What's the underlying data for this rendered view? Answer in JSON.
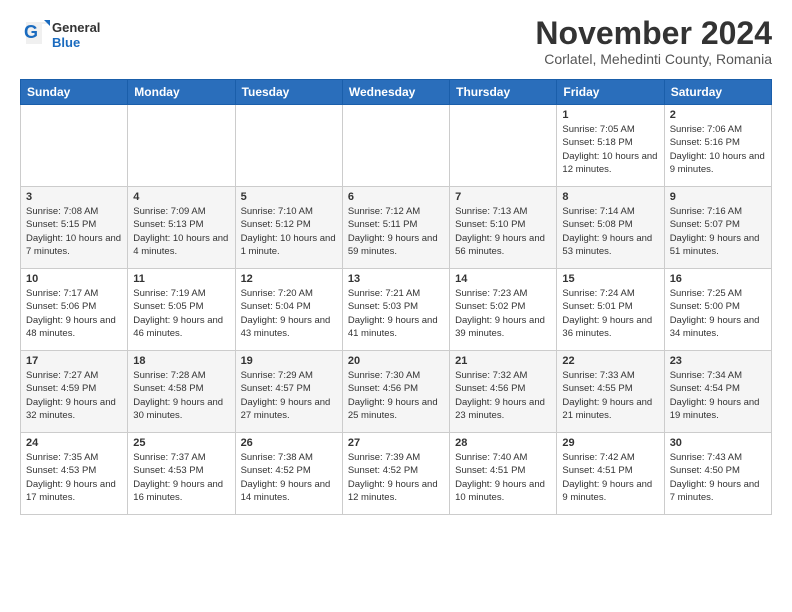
{
  "logo": {
    "general": "General",
    "blue": "Blue"
  },
  "title": "November 2024",
  "subtitle": "Corlatel, Mehedinti County, Romania",
  "headers": [
    "Sunday",
    "Monday",
    "Tuesday",
    "Wednesday",
    "Thursday",
    "Friday",
    "Saturday"
  ],
  "weeks": [
    [
      {
        "day": "",
        "info": ""
      },
      {
        "day": "",
        "info": ""
      },
      {
        "day": "",
        "info": ""
      },
      {
        "day": "",
        "info": ""
      },
      {
        "day": "",
        "info": ""
      },
      {
        "day": "1",
        "info": "Sunrise: 7:05 AM\nSunset: 5:18 PM\nDaylight: 10 hours and 12 minutes."
      },
      {
        "day": "2",
        "info": "Sunrise: 7:06 AM\nSunset: 5:16 PM\nDaylight: 10 hours and 9 minutes."
      }
    ],
    [
      {
        "day": "3",
        "info": "Sunrise: 7:08 AM\nSunset: 5:15 PM\nDaylight: 10 hours and 7 minutes."
      },
      {
        "day": "4",
        "info": "Sunrise: 7:09 AM\nSunset: 5:13 PM\nDaylight: 10 hours and 4 minutes."
      },
      {
        "day": "5",
        "info": "Sunrise: 7:10 AM\nSunset: 5:12 PM\nDaylight: 10 hours and 1 minute."
      },
      {
        "day": "6",
        "info": "Sunrise: 7:12 AM\nSunset: 5:11 PM\nDaylight: 9 hours and 59 minutes."
      },
      {
        "day": "7",
        "info": "Sunrise: 7:13 AM\nSunset: 5:10 PM\nDaylight: 9 hours and 56 minutes."
      },
      {
        "day": "8",
        "info": "Sunrise: 7:14 AM\nSunset: 5:08 PM\nDaylight: 9 hours and 53 minutes."
      },
      {
        "day": "9",
        "info": "Sunrise: 7:16 AM\nSunset: 5:07 PM\nDaylight: 9 hours and 51 minutes."
      }
    ],
    [
      {
        "day": "10",
        "info": "Sunrise: 7:17 AM\nSunset: 5:06 PM\nDaylight: 9 hours and 48 minutes."
      },
      {
        "day": "11",
        "info": "Sunrise: 7:19 AM\nSunset: 5:05 PM\nDaylight: 9 hours and 46 minutes."
      },
      {
        "day": "12",
        "info": "Sunrise: 7:20 AM\nSunset: 5:04 PM\nDaylight: 9 hours and 43 minutes."
      },
      {
        "day": "13",
        "info": "Sunrise: 7:21 AM\nSunset: 5:03 PM\nDaylight: 9 hours and 41 minutes."
      },
      {
        "day": "14",
        "info": "Sunrise: 7:23 AM\nSunset: 5:02 PM\nDaylight: 9 hours and 39 minutes."
      },
      {
        "day": "15",
        "info": "Sunrise: 7:24 AM\nSunset: 5:01 PM\nDaylight: 9 hours and 36 minutes."
      },
      {
        "day": "16",
        "info": "Sunrise: 7:25 AM\nSunset: 5:00 PM\nDaylight: 9 hours and 34 minutes."
      }
    ],
    [
      {
        "day": "17",
        "info": "Sunrise: 7:27 AM\nSunset: 4:59 PM\nDaylight: 9 hours and 32 minutes."
      },
      {
        "day": "18",
        "info": "Sunrise: 7:28 AM\nSunset: 4:58 PM\nDaylight: 9 hours and 30 minutes."
      },
      {
        "day": "19",
        "info": "Sunrise: 7:29 AM\nSunset: 4:57 PM\nDaylight: 9 hours and 27 minutes."
      },
      {
        "day": "20",
        "info": "Sunrise: 7:30 AM\nSunset: 4:56 PM\nDaylight: 9 hours and 25 minutes."
      },
      {
        "day": "21",
        "info": "Sunrise: 7:32 AM\nSunset: 4:56 PM\nDaylight: 9 hours and 23 minutes."
      },
      {
        "day": "22",
        "info": "Sunrise: 7:33 AM\nSunset: 4:55 PM\nDaylight: 9 hours and 21 minutes."
      },
      {
        "day": "23",
        "info": "Sunrise: 7:34 AM\nSunset: 4:54 PM\nDaylight: 9 hours and 19 minutes."
      }
    ],
    [
      {
        "day": "24",
        "info": "Sunrise: 7:35 AM\nSunset: 4:53 PM\nDaylight: 9 hours and 17 minutes."
      },
      {
        "day": "25",
        "info": "Sunrise: 7:37 AM\nSunset: 4:53 PM\nDaylight: 9 hours and 16 minutes."
      },
      {
        "day": "26",
        "info": "Sunrise: 7:38 AM\nSunset: 4:52 PM\nDaylight: 9 hours and 14 minutes."
      },
      {
        "day": "27",
        "info": "Sunrise: 7:39 AM\nSunset: 4:52 PM\nDaylight: 9 hours and 12 minutes."
      },
      {
        "day": "28",
        "info": "Sunrise: 7:40 AM\nSunset: 4:51 PM\nDaylight: 9 hours and 10 minutes."
      },
      {
        "day": "29",
        "info": "Sunrise: 7:42 AM\nSunset: 4:51 PM\nDaylight: 9 hours and 9 minutes."
      },
      {
        "day": "30",
        "info": "Sunrise: 7:43 AM\nSunset: 4:50 PM\nDaylight: 9 hours and 7 minutes."
      }
    ]
  ]
}
